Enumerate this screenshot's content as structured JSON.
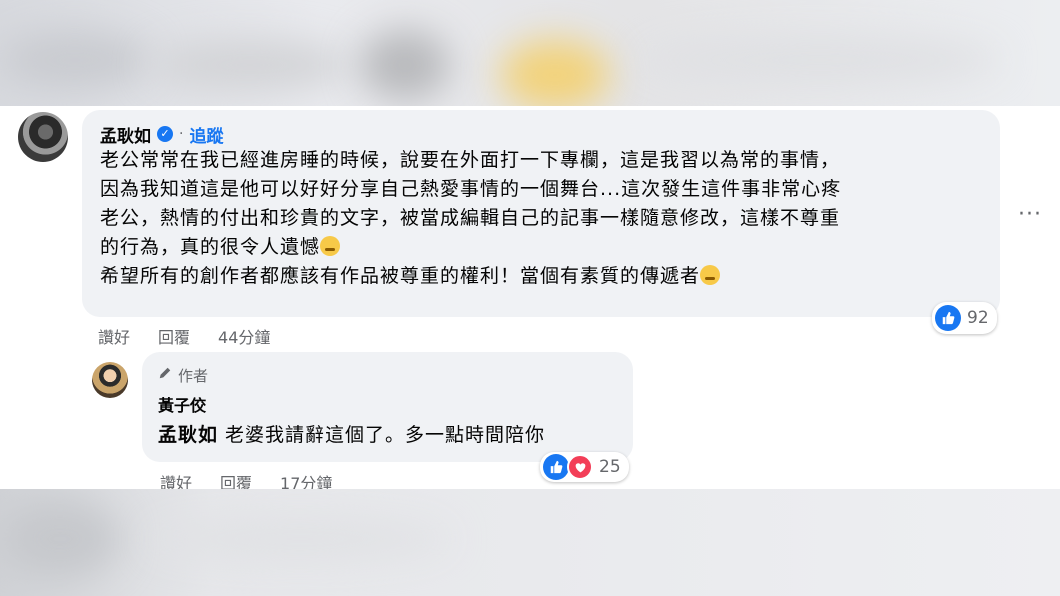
{
  "comment": {
    "author": "孟耿如",
    "follow_label": "追蹤",
    "dot": "·",
    "lines": [
      "老公常常在我已經進房睡的時候，說要在外面打一下專欄，這是我習以為常的事情，",
      "因為我知道這是他可以好好分享自己熱愛事情的一個舞台...這次發生這件事非常心疼",
      "老公，熱情的付出和珍貴的文字，被當成編輯自己的記事一樣隨意修改，這樣不尊重",
      "的行為，真的很令人遺憾",
      "希望所有的創作者都應該有作品被尊重的權利！當個有素質的傳遞者"
    ],
    "actions": {
      "like": "讚好",
      "reply": "回覆",
      "time": "44分鐘"
    },
    "reaction_count": "92",
    "more_label": "···"
  },
  "reply": {
    "badge": "作者",
    "author": "黃子佼",
    "mention": "孟耿如",
    "text": " 老婆我請辭這個了。多一點時間陪你",
    "actions": {
      "like": "讚好",
      "reply": "回覆",
      "time": "17分鐘"
    },
    "reaction_count": "25"
  },
  "colors": {
    "accent": "#1877f2",
    "love": "#f33e58",
    "bubble": "#f0f2f5",
    "muted": "#65676b"
  },
  "icons": [
    "verified-icon",
    "more-icon",
    "pencil-icon",
    "like-icon",
    "love-icon",
    "emoji-icon"
  ]
}
